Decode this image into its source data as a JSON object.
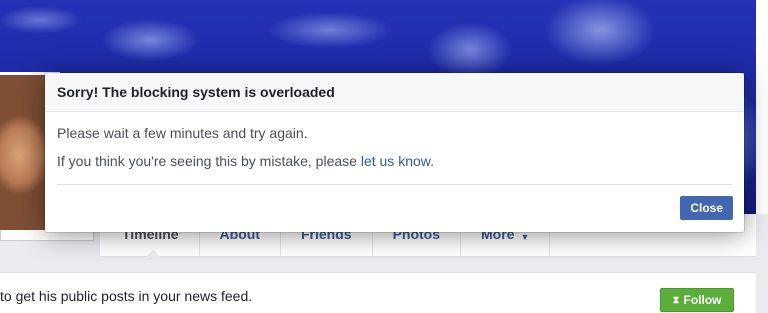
{
  "profile": {
    "tabs": [
      {
        "label": "Timeline"
      },
      {
        "label": "About"
      },
      {
        "label": "Friends"
      },
      {
        "label": "Photos"
      },
      {
        "label": "More"
      }
    ],
    "feed_text": "to get his public posts in your news feed.",
    "follow_label": "Follow"
  },
  "dialog": {
    "title": "Sorry! The blocking system is overloaded",
    "line1": "Please wait a few minutes and try again.",
    "line2_prefix": "If you think you're seeing this by mistake, please ",
    "line2_link": "let us know",
    "line2_suffix": ".",
    "close_label": "Close"
  },
  "colors": {
    "primary_button": "#4267b2",
    "follow_button": "#5cae3b",
    "link": "#365899"
  }
}
